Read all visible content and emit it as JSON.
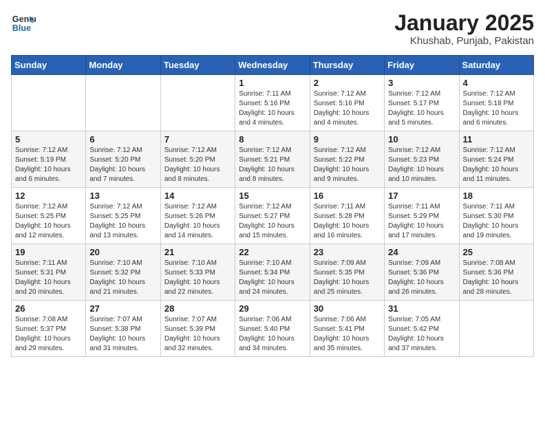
{
  "header": {
    "logo_general": "General",
    "logo_blue": "Blue",
    "month_year": "January 2025",
    "location": "Khushab, Punjab, Pakistan"
  },
  "weekdays": [
    "Sunday",
    "Monday",
    "Tuesday",
    "Wednesday",
    "Thursday",
    "Friday",
    "Saturday"
  ],
  "rows": [
    [
      {
        "day": "",
        "info": ""
      },
      {
        "day": "",
        "info": ""
      },
      {
        "day": "",
        "info": ""
      },
      {
        "day": "1",
        "info": "Sunrise: 7:11 AM\nSunset: 5:16 PM\nDaylight: 10 hours\nand 4 minutes."
      },
      {
        "day": "2",
        "info": "Sunrise: 7:12 AM\nSunset: 5:16 PM\nDaylight: 10 hours\nand 4 minutes."
      },
      {
        "day": "3",
        "info": "Sunrise: 7:12 AM\nSunset: 5:17 PM\nDaylight: 10 hours\nand 5 minutes."
      },
      {
        "day": "4",
        "info": "Sunrise: 7:12 AM\nSunset: 5:18 PM\nDaylight: 10 hours\nand 6 minutes."
      }
    ],
    [
      {
        "day": "5",
        "info": "Sunrise: 7:12 AM\nSunset: 5:19 PM\nDaylight: 10 hours\nand 6 minutes."
      },
      {
        "day": "6",
        "info": "Sunrise: 7:12 AM\nSunset: 5:20 PM\nDaylight: 10 hours\nand 7 minutes."
      },
      {
        "day": "7",
        "info": "Sunrise: 7:12 AM\nSunset: 5:20 PM\nDaylight: 10 hours\nand 8 minutes."
      },
      {
        "day": "8",
        "info": "Sunrise: 7:12 AM\nSunset: 5:21 PM\nDaylight: 10 hours\nand 8 minutes."
      },
      {
        "day": "9",
        "info": "Sunrise: 7:12 AM\nSunset: 5:22 PM\nDaylight: 10 hours\nand 9 minutes."
      },
      {
        "day": "10",
        "info": "Sunrise: 7:12 AM\nSunset: 5:23 PM\nDaylight: 10 hours\nand 10 minutes."
      },
      {
        "day": "11",
        "info": "Sunrise: 7:12 AM\nSunset: 5:24 PM\nDaylight: 10 hours\nand 11 minutes."
      }
    ],
    [
      {
        "day": "12",
        "info": "Sunrise: 7:12 AM\nSunset: 5:25 PM\nDaylight: 10 hours\nand 12 minutes."
      },
      {
        "day": "13",
        "info": "Sunrise: 7:12 AM\nSunset: 5:25 PM\nDaylight: 10 hours\nand 13 minutes."
      },
      {
        "day": "14",
        "info": "Sunrise: 7:12 AM\nSunset: 5:26 PM\nDaylight: 10 hours\nand 14 minutes."
      },
      {
        "day": "15",
        "info": "Sunrise: 7:12 AM\nSunset: 5:27 PM\nDaylight: 10 hours\nand 15 minutes."
      },
      {
        "day": "16",
        "info": "Sunrise: 7:11 AM\nSunset: 5:28 PM\nDaylight: 10 hours\nand 16 minutes."
      },
      {
        "day": "17",
        "info": "Sunrise: 7:11 AM\nSunset: 5:29 PM\nDaylight: 10 hours\nand 17 minutes."
      },
      {
        "day": "18",
        "info": "Sunrise: 7:11 AM\nSunset: 5:30 PM\nDaylight: 10 hours\nand 19 minutes."
      }
    ],
    [
      {
        "day": "19",
        "info": "Sunrise: 7:11 AM\nSunset: 5:31 PM\nDaylight: 10 hours\nand 20 minutes."
      },
      {
        "day": "20",
        "info": "Sunrise: 7:10 AM\nSunset: 5:32 PM\nDaylight: 10 hours\nand 21 minutes."
      },
      {
        "day": "21",
        "info": "Sunrise: 7:10 AM\nSunset: 5:33 PM\nDaylight: 10 hours\nand 22 minutes."
      },
      {
        "day": "22",
        "info": "Sunrise: 7:10 AM\nSunset: 5:34 PM\nDaylight: 10 hours\nand 24 minutes."
      },
      {
        "day": "23",
        "info": "Sunrise: 7:09 AM\nSunset: 5:35 PM\nDaylight: 10 hours\nand 25 minutes."
      },
      {
        "day": "24",
        "info": "Sunrise: 7:09 AM\nSunset: 5:36 PM\nDaylight: 10 hours\nand 26 minutes."
      },
      {
        "day": "25",
        "info": "Sunrise: 7:08 AM\nSunset: 5:36 PM\nDaylight: 10 hours\nand 28 minutes."
      }
    ],
    [
      {
        "day": "26",
        "info": "Sunrise: 7:08 AM\nSunset: 5:37 PM\nDaylight: 10 hours\nand 29 minutes."
      },
      {
        "day": "27",
        "info": "Sunrise: 7:07 AM\nSunset: 5:38 PM\nDaylight: 10 hours\nand 31 minutes."
      },
      {
        "day": "28",
        "info": "Sunrise: 7:07 AM\nSunset: 5:39 PM\nDaylight: 10 hours\nand 32 minutes."
      },
      {
        "day": "29",
        "info": "Sunrise: 7:06 AM\nSunset: 5:40 PM\nDaylight: 10 hours\nand 34 minutes."
      },
      {
        "day": "30",
        "info": "Sunrise: 7:06 AM\nSunset: 5:41 PM\nDaylight: 10 hours\nand 35 minutes."
      },
      {
        "day": "31",
        "info": "Sunrise: 7:05 AM\nSunset: 5:42 PM\nDaylight: 10 hours\nand 37 minutes."
      },
      {
        "day": "",
        "info": ""
      }
    ]
  ]
}
